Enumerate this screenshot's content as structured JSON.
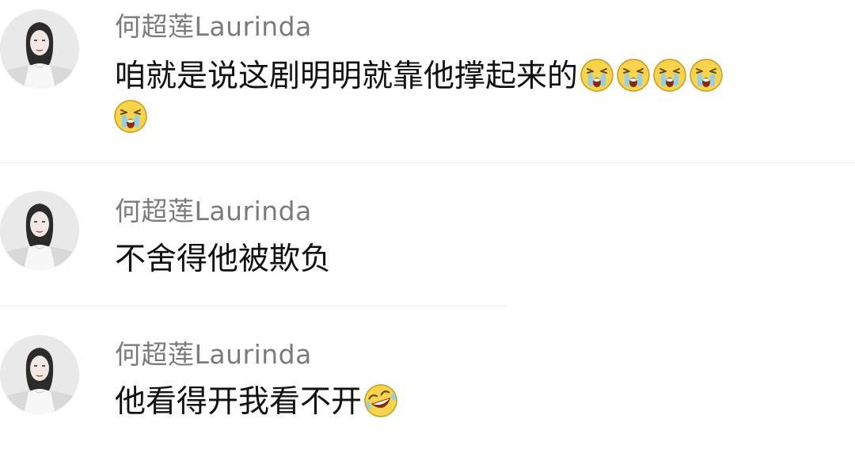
{
  "comments": [
    {
      "username": "何超莲Laurinda",
      "text": "咱就是说这剧明明就靠他撑起来的",
      "emojis": [
        "crying-emoji",
        "crying-emoji",
        "crying-emoji",
        "crying-emoji",
        "crying-emoji"
      ]
    },
    {
      "username": "何超莲Laurinda",
      "text": "不舍得他被欺负",
      "emojis": []
    },
    {
      "username": "何超莲Laurinda",
      "text": "他看得开我看不开",
      "emojis": [
        "laugh-cry-emoji"
      ]
    }
  ],
  "colors": {
    "username": "#7b7b7b",
    "text": "#111111",
    "emoji_face": "#f7d44c",
    "emoji_outline": "#c99a1a"
  }
}
